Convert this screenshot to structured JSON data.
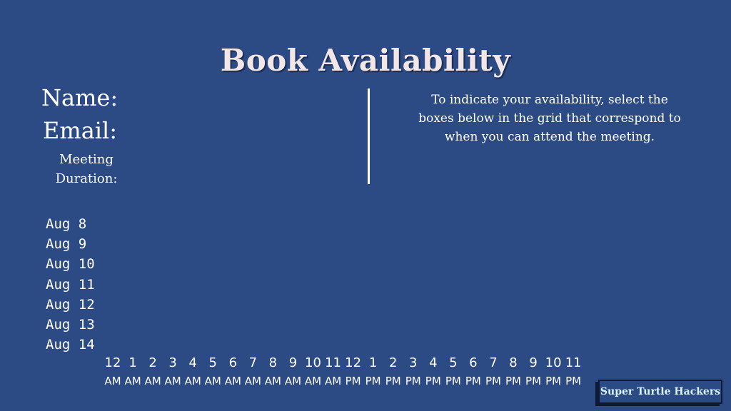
{
  "title": "Book Availability",
  "form": {
    "name_label": "Name:",
    "email_label": "Email:",
    "duration_label": "Meeting Duration:"
  },
  "instructions": "To indicate your availability, select the boxes below in the grid that correspond to when you can attend the meeting.",
  "dates": [
    "Aug 8",
    "Aug 9",
    "Aug 10",
    "Aug 11",
    "Aug 12",
    "Aug 13",
    "Aug 14"
  ],
  "hours": [
    {
      "hour": "12",
      "period": "AM"
    },
    {
      "hour": "1",
      "period": "AM"
    },
    {
      "hour": "2",
      "period": "AM"
    },
    {
      "hour": "3",
      "period": "AM"
    },
    {
      "hour": "4",
      "period": "AM"
    },
    {
      "hour": "5",
      "period": "AM"
    },
    {
      "hour": "6",
      "period": "AM"
    },
    {
      "hour": "7",
      "period": "AM"
    },
    {
      "hour": "8",
      "period": "AM"
    },
    {
      "hour": "9",
      "period": "AM"
    },
    {
      "hour": "10",
      "period": "AM"
    },
    {
      "hour": "11",
      "period": "AM"
    },
    {
      "hour": "12",
      "period": "PM"
    },
    {
      "hour": "1",
      "period": "PM"
    },
    {
      "hour": "2",
      "period": "PM"
    },
    {
      "hour": "3",
      "period": "PM"
    },
    {
      "hour": "4",
      "period": "PM"
    },
    {
      "hour": "5",
      "period": "PM"
    },
    {
      "hour": "6",
      "period": "PM"
    },
    {
      "hour": "7",
      "period": "PM"
    },
    {
      "hour": "8",
      "period": "PM"
    },
    {
      "hour": "9",
      "period": "PM"
    },
    {
      "hour": "10",
      "period": "PM"
    },
    {
      "hour": "11",
      "period": "PM"
    }
  ],
  "brand": "Super Turtle Hackers",
  "colors": {
    "background": "#2c4b84",
    "title": "#f2e6e6",
    "text": "#ffffff",
    "brand_text": "#d9f2ff"
  }
}
